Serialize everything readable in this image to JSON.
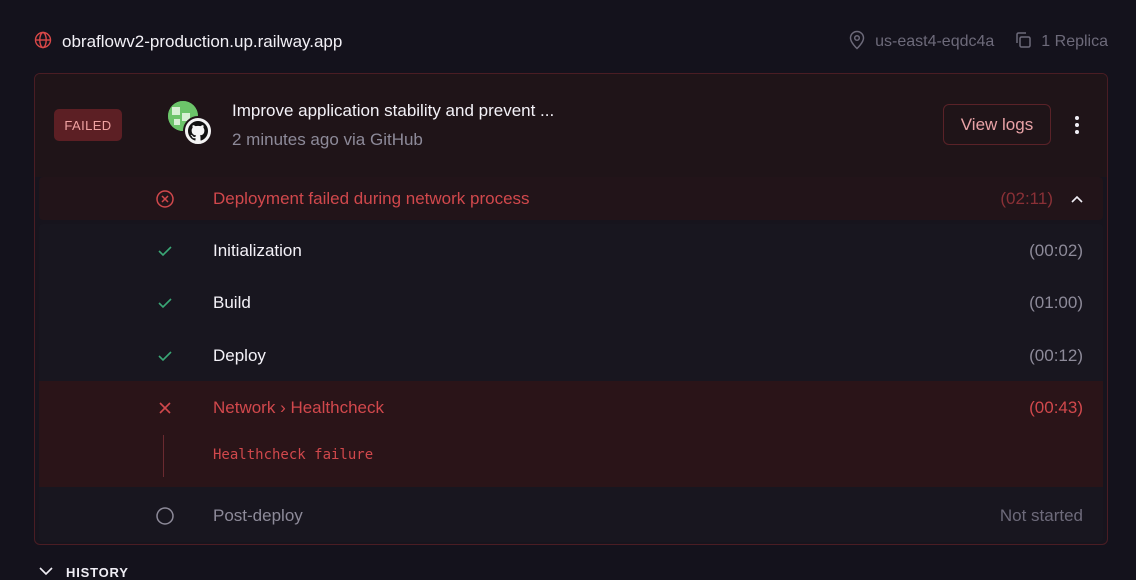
{
  "service": {
    "domain": "obraflowv2-production.up.railway.app",
    "region": "us-east4-eqdc4a",
    "replicas": "1 Replica"
  },
  "deployment": {
    "status": "FAILED",
    "commit_message": "Improve application stability and prevent ...",
    "subtitle": "2 minutes ago via GitHub",
    "view_logs_label": "View logs",
    "failure_summary": "Deployment failed during network process",
    "failure_time": "(02:11)"
  },
  "steps": [
    {
      "label": "Initialization",
      "time": "(00:02)",
      "status": "success"
    },
    {
      "label": "Build",
      "time": "(01:00)",
      "status": "success"
    },
    {
      "label": "Deploy",
      "time": "(00:12)",
      "status": "success"
    },
    {
      "label": "Network › Healthcheck",
      "time": "(00:43)",
      "status": "failed",
      "log": "Healthcheck failure"
    },
    {
      "label": "Post-deploy",
      "time": "Not started",
      "status": "pending"
    }
  ],
  "history_label": "HISTORY",
  "colors": {
    "background": "#14121c",
    "error": "#d1484c",
    "success": "#3aa776",
    "muted": "#8d8a99"
  }
}
